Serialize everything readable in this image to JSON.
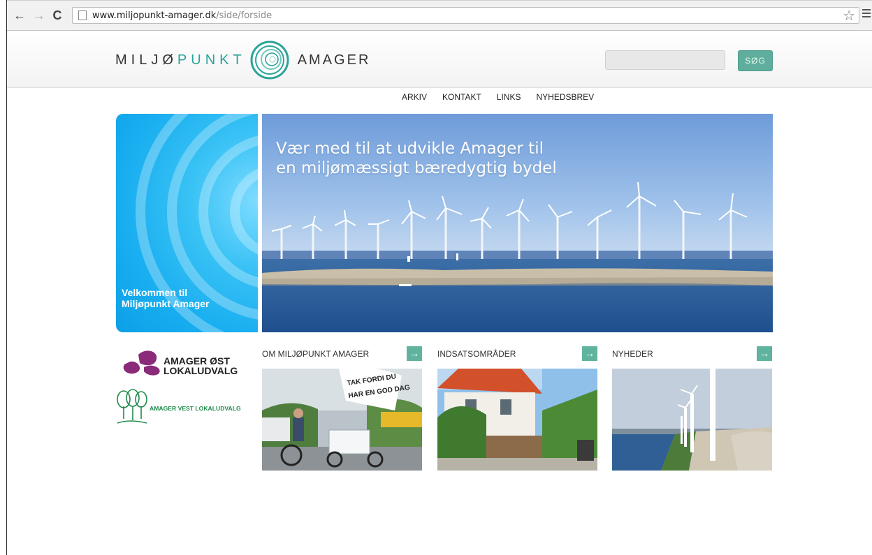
{
  "browser": {
    "url_host": "www.miljopunkt-amager.dk",
    "url_path": "/side/forside"
  },
  "logo": {
    "part1": "MILJØ",
    "part2": "PUNKT",
    "part3": "AMAGER"
  },
  "search": {
    "button_label": "SØG"
  },
  "topnav": [
    "ARKIV",
    "KONTAKT",
    "LINKS",
    "NYHEDSBREV"
  ],
  "welcome": {
    "line1": "Velkommen til",
    "line2": "Miljøpunkt Amager"
  },
  "hero": {
    "line1": "Vær med til at udvikle Amager til",
    "line2": "en miljømæssigt bæredygtig bydel"
  },
  "partners": {
    "ost_line1": "AMAGER ØST",
    "ost_line2": "LOKALUDVALG",
    "vest": "AMAGER VEST LOKALUDVALG"
  },
  "sections": [
    {
      "title": "OM MILJØPUNKT AMAGER",
      "image_sign1": "TAK FORDI DU",
      "image_sign2": "HAR EN GOD DAG"
    },
    {
      "title": "INDSATSOMRÅDER"
    },
    {
      "title": "NYHEDER"
    }
  ],
  "icons": {
    "arrow": "→"
  },
  "colors": {
    "accent": "#5fb39f",
    "welcome_blue": "#18aef0",
    "logo_teal": "#2aa39a",
    "ost_purple": "#8b2a78",
    "vest_green": "#1f8b4c"
  }
}
